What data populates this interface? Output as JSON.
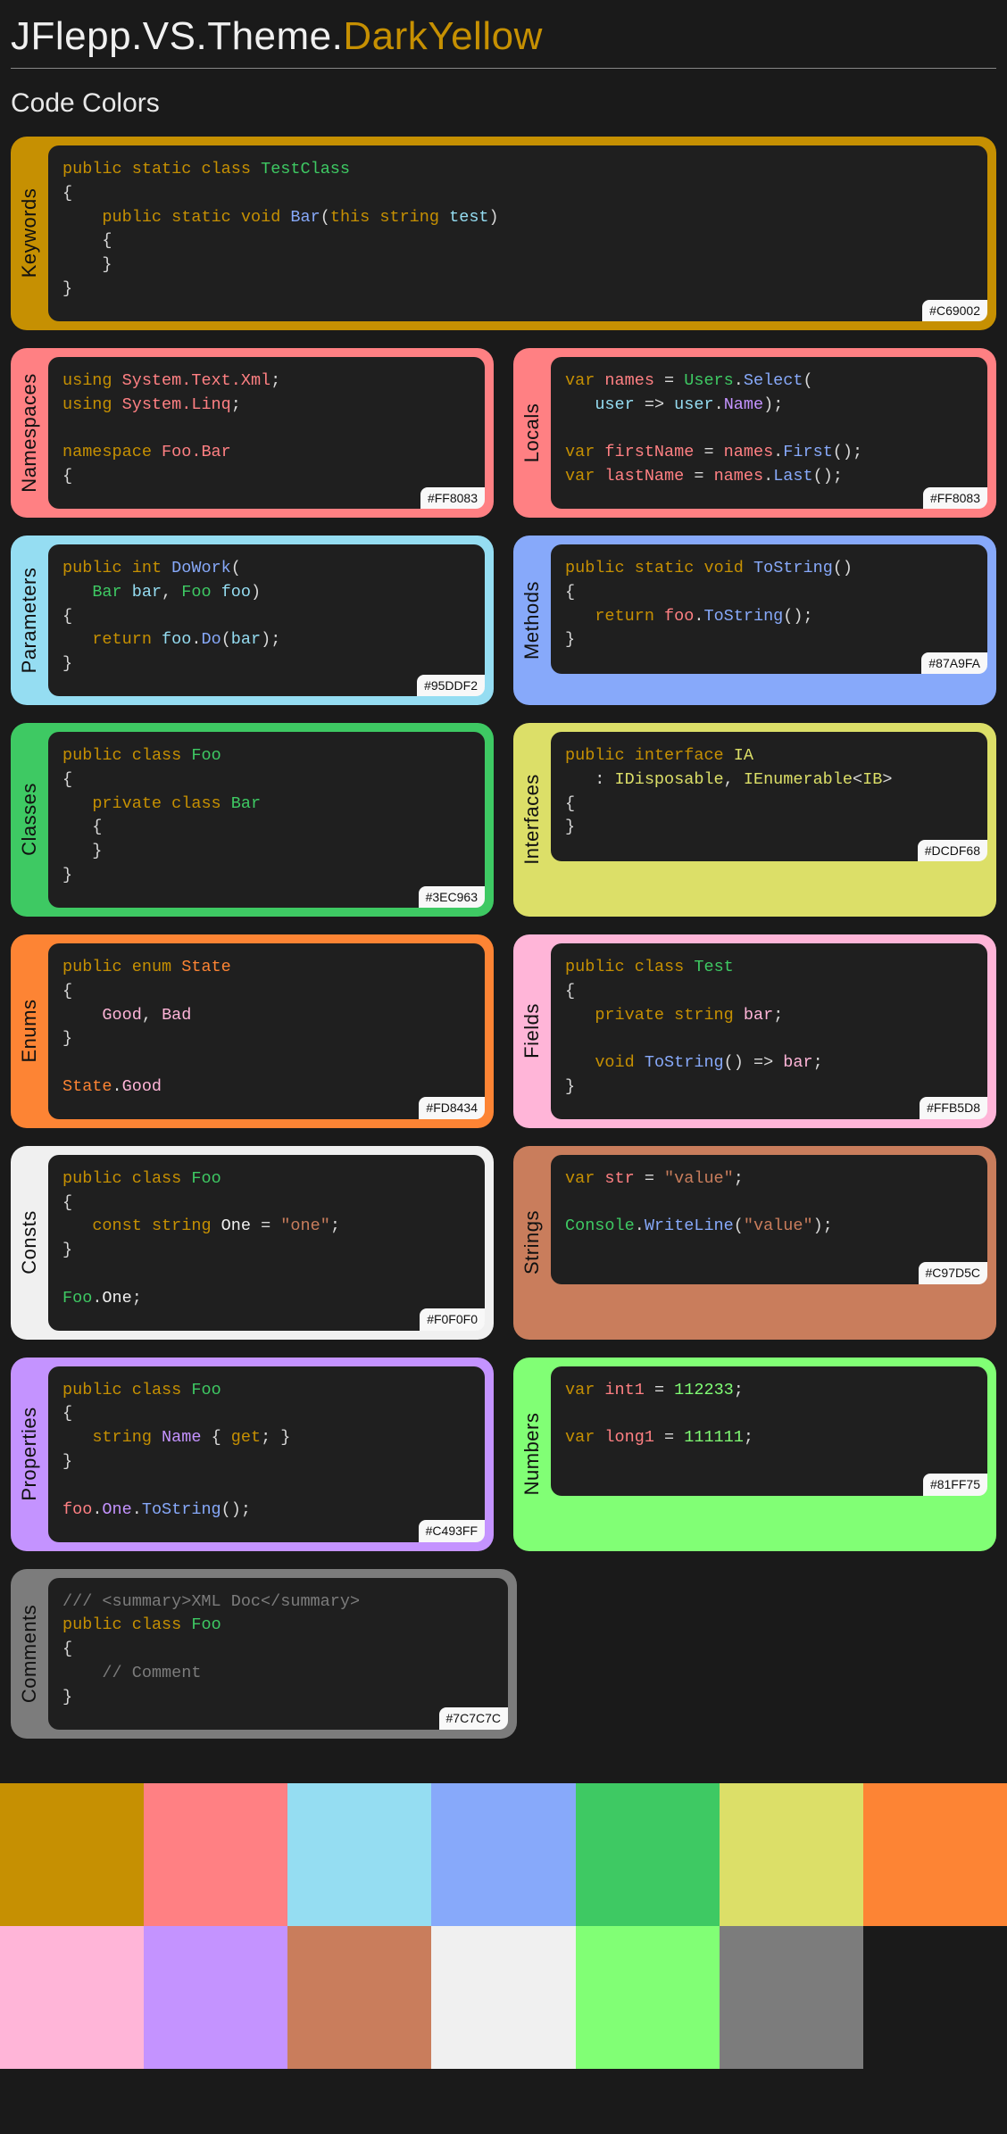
{
  "title_prefix": "JFlepp.VS.Theme.",
  "title_suffix": "DarkYellow",
  "subtitle": "Code Colors",
  "cards": {
    "keywords": {
      "label": "Keywords",
      "hex": "#C69002",
      "bg": "#C69002"
    },
    "namespaces": {
      "label": "Namespaces",
      "hex": "#FF8083",
      "bg": "#FF8083"
    },
    "locals": {
      "label": "Locals",
      "hex": "#FF8083",
      "bg": "#FF8083"
    },
    "parameters": {
      "label": "Parameters",
      "hex": "#95DDF2",
      "bg": "#95DDF2"
    },
    "methods": {
      "label": "Methods",
      "hex": "#87A9FA",
      "bg": "#87A9FA"
    },
    "classes": {
      "label": "Classes",
      "hex": "#3EC963",
      "bg": "#3EC963"
    },
    "interfaces": {
      "label": "Interfaces",
      "hex": "#DCDF68",
      "bg": "#DCDF68"
    },
    "enums": {
      "label": "Enums",
      "hex": "#FD8434",
      "bg": "#FD8434"
    },
    "fields": {
      "label": "Fields",
      "hex": "#FFB5D8",
      "bg": "#FFB5D8"
    },
    "consts": {
      "label": "Consts",
      "hex": "#F0F0F0",
      "bg": "#F0F0F0"
    },
    "strings": {
      "label": "Strings",
      "hex": "#C97D5C",
      "bg": "#C97D5C"
    },
    "properties": {
      "label": "Properties",
      "hex": "#C493FF",
      "bg": "#C493FF"
    },
    "numbers": {
      "label": "Numbers",
      "hex": "#81FF75",
      "bg": "#81FF75"
    },
    "comments": {
      "label": "Comments",
      "hex": "#7C7C7C",
      "bg": "#7C7C7C"
    }
  },
  "code": {
    "keywords": [
      [
        [
          "public",
          "kw"
        ],
        [
          " ",
          "pun"
        ],
        [
          "static",
          "kw"
        ],
        [
          " ",
          "pun"
        ],
        [
          "class",
          "kw"
        ],
        [
          " ",
          "pun"
        ],
        [
          "TestClass",
          "cls"
        ]
      ],
      [
        [
          "{",
          "pun"
        ]
      ],
      [
        [
          "    ",
          "pun"
        ],
        [
          "public",
          "kw"
        ],
        [
          " ",
          "pun"
        ],
        [
          "static",
          "kw"
        ],
        [
          " ",
          "pun"
        ],
        [
          "void",
          "kw"
        ],
        [
          " ",
          "pun"
        ],
        [
          "Bar",
          "meth"
        ],
        [
          "(",
          "pun"
        ],
        [
          "this",
          "kw"
        ],
        [
          " ",
          "pun"
        ],
        [
          "string",
          "kw"
        ],
        [
          " ",
          "pun"
        ],
        [
          "test",
          "parm"
        ],
        [
          ")",
          "pun"
        ]
      ],
      [
        [
          "    {",
          "pun"
        ]
      ],
      [
        [
          "    }",
          "pun"
        ]
      ],
      [
        [
          "}",
          "pun"
        ]
      ]
    ],
    "namespaces": [
      [
        [
          "using",
          "kw"
        ],
        [
          " ",
          "pun"
        ],
        [
          "System.Text.Xml",
          "ns"
        ],
        [
          ";",
          "pun"
        ]
      ],
      [
        [
          "using",
          "kw"
        ],
        [
          " ",
          "pun"
        ],
        [
          "System.Linq",
          "ns"
        ],
        [
          ";",
          "pun"
        ]
      ],
      [
        [
          "",
          "pun"
        ]
      ],
      [
        [
          "namespace",
          "kw"
        ],
        [
          " ",
          "pun"
        ],
        [
          "Foo.Bar",
          "ns"
        ]
      ],
      [
        [
          "{",
          "pun"
        ]
      ]
    ],
    "locals": [
      [
        [
          "var",
          "kw"
        ],
        [
          " ",
          "pun"
        ],
        [
          "names",
          "ns"
        ],
        [
          " = ",
          "pun"
        ],
        [
          "Users",
          "cls"
        ],
        [
          ".",
          "pun"
        ],
        [
          "Select",
          "meth"
        ],
        [
          "(",
          "pun"
        ]
      ],
      [
        [
          "   ",
          "pun"
        ],
        [
          "user",
          "parm"
        ],
        [
          " => ",
          "pun"
        ],
        [
          "user",
          "parm"
        ],
        [
          ".",
          "pun"
        ],
        [
          "Name",
          "prop"
        ],
        [
          ");",
          "pun"
        ]
      ],
      [
        [
          "",
          "pun"
        ]
      ],
      [
        [
          "var",
          "kw"
        ],
        [
          " ",
          "pun"
        ],
        [
          "firstName",
          "ns"
        ],
        [
          " = ",
          "pun"
        ],
        [
          "names",
          "ns"
        ],
        [
          ".",
          "pun"
        ],
        [
          "First",
          "meth"
        ],
        [
          "();",
          "pun"
        ]
      ],
      [
        [
          "var",
          "kw"
        ],
        [
          " ",
          "pun"
        ],
        [
          "lastName",
          "ns"
        ],
        [
          " = ",
          "pun"
        ],
        [
          "names",
          "ns"
        ],
        [
          ".",
          "pun"
        ],
        [
          "Last",
          "meth"
        ],
        [
          "();",
          "pun"
        ]
      ]
    ],
    "parameters": [
      [
        [
          "public",
          "kw"
        ],
        [
          " ",
          "pun"
        ],
        [
          "int",
          "kw"
        ],
        [
          " ",
          "pun"
        ],
        [
          "DoWork",
          "meth"
        ],
        [
          "(",
          "pun"
        ]
      ],
      [
        [
          "   ",
          "pun"
        ],
        [
          "Bar",
          "cls"
        ],
        [
          " ",
          "pun"
        ],
        [
          "bar",
          "parm"
        ],
        [
          ", ",
          "pun"
        ],
        [
          "Foo",
          "cls"
        ],
        [
          " ",
          "pun"
        ],
        [
          "foo",
          "parm"
        ],
        [
          ")",
          "pun"
        ]
      ],
      [
        [
          "{",
          "pun"
        ]
      ],
      [
        [
          "   ",
          "pun"
        ],
        [
          "return",
          "kw"
        ],
        [
          " ",
          "pun"
        ],
        [
          "foo",
          "parm"
        ],
        [
          ".",
          "pun"
        ],
        [
          "Do",
          "meth"
        ],
        [
          "(",
          "pun"
        ],
        [
          "bar",
          "parm"
        ],
        [
          ");",
          "pun"
        ]
      ],
      [
        [
          "}",
          "pun"
        ]
      ]
    ],
    "methods": [
      [
        [
          "public",
          "kw"
        ],
        [
          " ",
          "pun"
        ],
        [
          "static",
          "kw"
        ],
        [
          " ",
          "pun"
        ],
        [
          "void",
          "kw"
        ],
        [
          " ",
          "pun"
        ],
        [
          "ToString",
          "meth"
        ],
        [
          "()",
          "pun"
        ]
      ],
      [
        [
          "{",
          "pun"
        ]
      ],
      [
        [
          "   ",
          "pun"
        ],
        [
          "return",
          "kw"
        ],
        [
          " ",
          "pun"
        ],
        [
          "foo",
          "ns"
        ],
        [
          ".",
          "pun"
        ],
        [
          "ToString",
          "meth"
        ],
        [
          "();",
          "pun"
        ]
      ],
      [
        [
          "}",
          "pun"
        ]
      ]
    ],
    "classes": [
      [
        [
          "public",
          "kw"
        ],
        [
          " ",
          "pun"
        ],
        [
          "class",
          "kw"
        ],
        [
          " ",
          "pun"
        ],
        [
          "Foo",
          "cls"
        ]
      ],
      [
        [
          "{",
          "pun"
        ]
      ],
      [
        [
          "   ",
          "pun"
        ],
        [
          "private",
          "kw"
        ],
        [
          " ",
          "pun"
        ],
        [
          "class",
          "kw"
        ],
        [
          " ",
          "pun"
        ],
        [
          "Bar",
          "cls"
        ]
      ],
      [
        [
          "   {",
          "pun"
        ]
      ],
      [
        [
          "   }",
          "pun"
        ]
      ],
      [
        [
          "}",
          "pun"
        ]
      ]
    ],
    "interfaces": [
      [
        [
          "public",
          "kw"
        ],
        [
          " ",
          "pun"
        ],
        [
          "interface",
          "kw"
        ],
        [
          " ",
          "pun"
        ],
        [
          "IA",
          "iface"
        ]
      ],
      [
        [
          "   : ",
          "pun"
        ],
        [
          "IDisposable",
          "iface"
        ],
        [
          ", ",
          "pun"
        ],
        [
          "IEnumerable",
          "iface"
        ],
        [
          "<",
          "pun"
        ],
        [
          "IB",
          "iface"
        ],
        [
          ">",
          "pun"
        ]
      ],
      [
        [
          "{",
          "pun"
        ]
      ],
      [
        [
          "}",
          "pun"
        ]
      ]
    ],
    "enums": [
      [
        [
          "public",
          "kw"
        ],
        [
          " ",
          "pun"
        ],
        [
          "enum",
          "kw"
        ],
        [
          " ",
          "pun"
        ],
        [
          "State",
          "enum"
        ]
      ],
      [
        [
          "{",
          "pun"
        ]
      ],
      [
        [
          "    ",
          "pun"
        ],
        [
          "Good",
          "fld"
        ],
        [
          ", ",
          "pun"
        ],
        [
          "Bad",
          "fld"
        ]
      ],
      [
        [
          "}",
          "pun"
        ]
      ],
      [
        [
          "",
          "pun"
        ]
      ],
      [
        [
          "State",
          "enum"
        ],
        [
          ".",
          "pun"
        ],
        [
          "Good",
          "fld"
        ]
      ]
    ],
    "fields": [
      [
        [
          "public",
          "kw"
        ],
        [
          " ",
          "pun"
        ],
        [
          "class",
          "kw"
        ],
        [
          " ",
          "pun"
        ],
        [
          "Test",
          "cls"
        ]
      ],
      [
        [
          "{",
          "pun"
        ]
      ],
      [
        [
          "   ",
          "pun"
        ],
        [
          "private",
          "kw"
        ],
        [
          " ",
          "pun"
        ],
        [
          "string",
          "kw"
        ],
        [
          " ",
          "pun"
        ],
        [
          "bar",
          "fld"
        ],
        [
          ";",
          "pun"
        ]
      ],
      [
        [
          "",
          "pun"
        ]
      ],
      [
        [
          "   ",
          "pun"
        ],
        [
          "void",
          "kw"
        ],
        [
          " ",
          "pun"
        ],
        [
          "ToString",
          "meth"
        ],
        [
          "() => ",
          "pun"
        ],
        [
          "bar",
          "fld"
        ],
        [
          ";",
          "pun"
        ]
      ],
      [
        [
          "}",
          "pun"
        ]
      ]
    ],
    "consts": [
      [
        [
          "public",
          "kw"
        ],
        [
          " ",
          "pun"
        ],
        [
          "class",
          "kw"
        ],
        [
          " ",
          "pun"
        ],
        [
          "Foo",
          "cls"
        ]
      ],
      [
        [
          "{",
          "pun"
        ]
      ],
      [
        [
          "   ",
          "pun"
        ],
        [
          "const",
          "kw"
        ],
        [
          " ",
          "pun"
        ],
        [
          "string",
          "kw"
        ],
        [
          " ",
          "pun"
        ],
        [
          "One",
          "cnst"
        ],
        [
          " = ",
          "pun"
        ],
        [
          "\"one\"",
          "str"
        ],
        [
          ";",
          "pun"
        ]
      ],
      [
        [
          "}",
          "pun"
        ]
      ],
      [
        [
          "",
          "pun"
        ]
      ],
      [
        [
          "Foo",
          "cls"
        ],
        [
          ".",
          "pun"
        ],
        [
          "One",
          "cnst"
        ],
        [
          ";",
          "pun"
        ]
      ]
    ],
    "strings": [
      [
        [
          "var",
          "kw"
        ],
        [
          " ",
          "pun"
        ],
        [
          "str",
          "ns"
        ],
        [
          " = ",
          "pun"
        ],
        [
          "\"value\"",
          "str"
        ],
        [
          ";",
          "pun"
        ]
      ],
      [
        [
          "",
          "pun"
        ]
      ],
      [
        [
          "Console",
          "cls"
        ],
        [
          ".",
          "pun"
        ],
        [
          "WriteLine",
          "meth"
        ],
        [
          "(",
          "pun"
        ],
        [
          "\"value\"",
          "str"
        ],
        [
          ");",
          "pun"
        ]
      ]
    ],
    "properties": [
      [
        [
          "public",
          "kw"
        ],
        [
          " ",
          "pun"
        ],
        [
          "class",
          "kw"
        ],
        [
          " ",
          "pun"
        ],
        [
          "Foo",
          "cls"
        ]
      ],
      [
        [
          "{",
          "pun"
        ]
      ],
      [
        [
          "   ",
          "pun"
        ],
        [
          "string",
          "kw"
        ],
        [
          " ",
          "pun"
        ],
        [
          "Name",
          "prop"
        ],
        [
          " { ",
          "pun"
        ],
        [
          "get",
          "kw"
        ],
        [
          "; }",
          "pun"
        ]
      ],
      [
        [
          "}",
          "pun"
        ]
      ],
      [
        [
          "",
          "pun"
        ]
      ],
      [
        [
          "foo",
          "ns"
        ],
        [
          ".",
          "pun"
        ],
        [
          "One",
          "prop"
        ],
        [
          ".",
          "pun"
        ],
        [
          "ToString",
          "meth"
        ],
        [
          "();",
          "pun"
        ]
      ]
    ],
    "numbers": [
      [
        [
          "var",
          "kw"
        ],
        [
          " ",
          "pun"
        ],
        [
          "int1",
          "ns"
        ],
        [
          " = ",
          "pun"
        ],
        [
          "112233",
          "num"
        ],
        [
          ";",
          "pun"
        ]
      ],
      [
        [
          "",
          "pun"
        ]
      ],
      [
        [
          "var",
          "kw"
        ],
        [
          " ",
          "pun"
        ],
        [
          "long1",
          "ns"
        ],
        [
          " = ",
          "pun"
        ],
        [
          "111111",
          "num"
        ],
        [
          ";",
          "pun"
        ]
      ]
    ],
    "comments": [
      [
        [
          "/// <summary>XML Doc</summary>",
          "cmt"
        ]
      ],
      [
        [
          "public",
          "kw"
        ],
        [
          " ",
          "pun"
        ],
        [
          "class",
          "kw"
        ],
        [
          " ",
          "pun"
        ],
        [
          "Foo",
          "cls"
        ]
      ],
      [
        [
          "{",
          "pun"
        ]
      ],
      [
        [
          "    ",
          "pun"
        ],
        [
          "// Comment",
          "cmt"
        ]
      ],
      [
        [
          "}",
          "pun"
        ]
      ]
    ]
  },
  "swatches_row1": [
    "#C69002",
    "#FF8083",
    "#95DDF2",
    "#87A9FA",
    "#3EC963",
    "#DCDF68",
    "#FD8434"
  ],
  "swatches_row2": [
    "#FFB5D8",
    "#C493FF",
    "#C97D5C",
    "#F0F0F0",
    "#81FF75",
    "#7C7C7C",
    "#1a1a1a"
  ]
}
